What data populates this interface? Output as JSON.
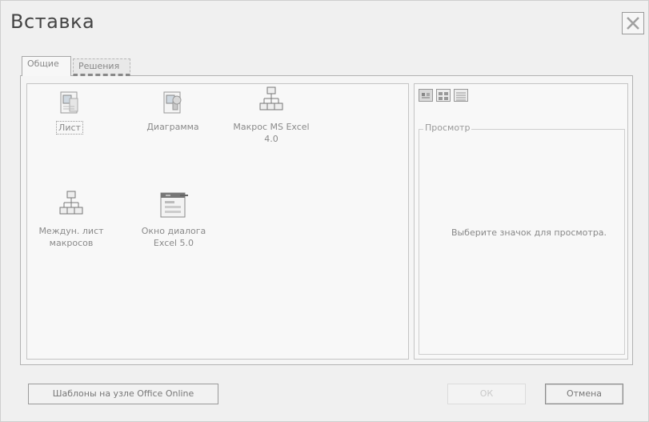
{
  "dialog": {
    "title": "Вставка",
    "close_icon": "close-x-icon"
  },
  "tabs": [
    {
      "label": "Общие",
      "active": true
    },
    {
      "label": "Решения",
      "active": false
    }
  ],
  "items": [
    {
      "label": "Лист",
      "icon": "worksheet-icon",
      "selected": true
    },
    {
      "label": "Диаграмма",
      "icon": "chart-sheet-icon",
      "selected": false
    },
    {
      "label": "Макрос MS Excel 4.0",
      "icon": "macro-network-icon",
      "selected": false
    },
    {
      "label": "Междун. лист макросов",
      "icon": "macro-network-icon",
      "selected": false
    },
    {
      "label": "Окно диалога Excel 5.0",
      "icon": "dialog-sheet-icon",
      "selected": false
    }
  ],
  "view_buttons": [
    {
      "icon": "large-icons-view-icon",
      "active": true
    },
    {
      "icon": "list-view-icon",
      "active": false
    },
    {
      "icon": "details-view-icon",
      "active": false
    }
  ],
  "preview": {
    "legend": "Просмотр",
    "message": "Выберите значок для просмотра."
  },
  "buttons": {
    "templates": "Шаблоны на узле Office Online",
    "ok": "ОК",
    "cancel": "Отмена"
  }
}
